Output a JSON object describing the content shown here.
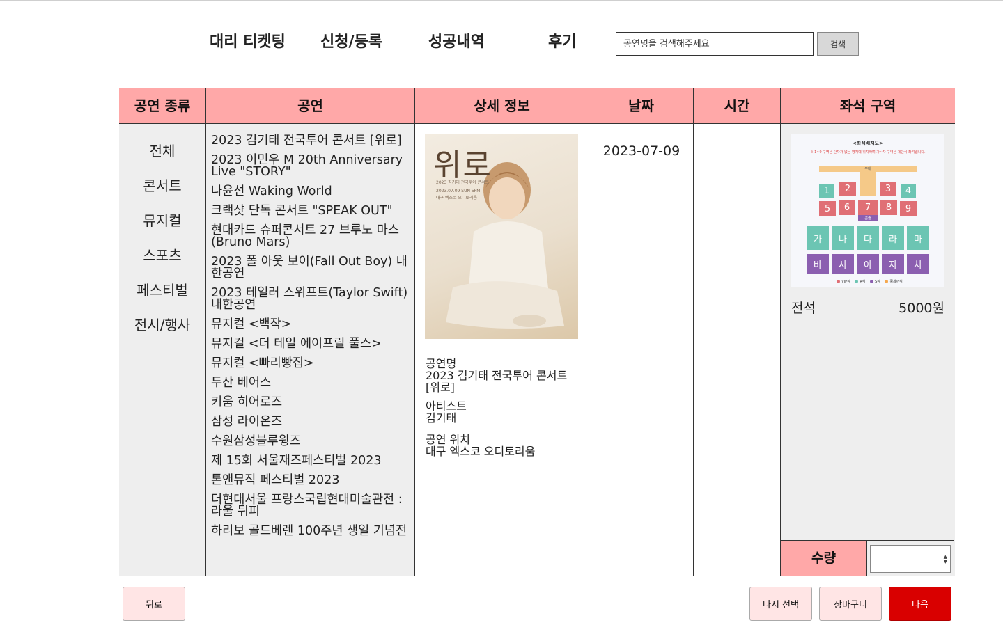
{
  "nav": {
    "items": [
      "대리 티켓팅",
      "신청/등록",
      "성공내역",
      "후기"
    ],
    "search_placeholder": "공연명을 검색해주세요",
    "search_button": "검색"
  },
  "table": {
    "headers": [
      "공연 종류",
      "공연",
      "상세 정보",
      "날짜",
      "시간",
      "좌석 구역"
    ],
    "categories": [
      "전체",
      "콘서트",
      "뮤지컬",
      "스포츠",
      "페스티벌",
      "전시/행사"
    ],
    "shows": [
      "2023 김기태 전국투어 콘서트 [위로]",
      "2023 이민우 M 20th Anniversary Live \"STORY\"",
      "나윤선 Waking World",
      "크랙샷 단독 콘서트 \"SPEAK OUT\"",
      "현대카드 슈퍼콘서트 27 브루노 마스(Bruno Mars)",
      "2023 폴 아웃 보이(Fall Out Boy) 내한공연",
      "2023 테일러 스위프트(Taylor Swift) 내한공연",
      "뮤지컬 <백작>",
      "뮤지컬 <더 테일 에이프릴 풀스>",
      "뮤지컬 <빠리빵집>",
      "두산 베어스",
      "키움 히어로즈",
      "삼성 라이온즈",
      "수원삼성블루윙즈",
      "제 15회 서울재즈페스티벌 2023",
      "톤앤뮤직 페스티벌 2023",
      "더현대서울 프랑스국립현대미술관전 : 라울 뒤피",
      "하리보 골드베렌 100주년 생일 기념전"
    ],
    "detail": {
      "poster": {
        "title": "위로",
        "line1": "2023 김기태 전국투어 콘서트",
        "line2": "2023.07.09 SUN 5PM",
        "line3": "대구 엑스코 오디토리움"
      },
      "label_name": "공연명",
      "value_name": "2023 김기태 전국투어 콘서트 [위로]",
      "label_artist": "아티스트",
      "value_artist": "김기태",
      "label_venue": "공연 위치",
      "value_venue": "대구 엑스코 오디토리움"
    },
    "date": "2023-07-09",
    "seat": {
      "map_title": "<좌석배치도>",
      "map_note": "※ 1~9 구역은 단차가 없는 평지에 위치하며 가~차 구역은 계단식 좌석입니다.",
      "stage": "무대",
      "console": "콘솔",
      "blocks_top": [
        "1",
        "2",
        "3",
        "4"
      ],
      "blocks_mid": [
        "5",
        "6",
        "7",
        "8",
        "9"
      ],
      "blocks_row1": [
        "가",
        "나",
        "다",
        "라",
        "마"
      ],
      "blocks_row2": [
        "바",
        "사",
        "아",
        "자",
        "차"
      ],
      "legend": [
        "VIP석",
        "R석",
        "S석",
        "휠체어석"
      ],
      "colors": {
        "red": "#e06f75",
        "teal": "#6cc5b3",
        "purple": "#8b5fb0",
        "stage": "#f5c988",
        "header": "#ffa8a8"
      },
      "name": "전석",
      "price": "5000원",
      "qty_label": "수량"
    }
  },
  "buttons": {
    "back": "뒤로",
    "reselect": "다시 선택",
    "cart": "장바구니",
    "next": "다음"
  }
}
